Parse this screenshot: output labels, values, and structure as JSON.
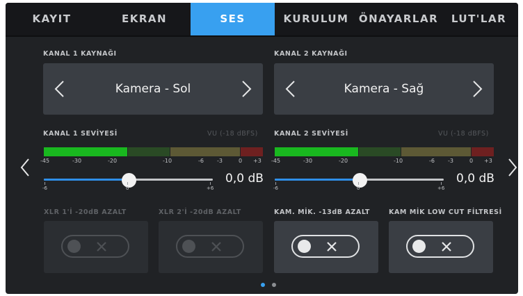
{
  "tabs": [
    "KAYIT",
    "EKRAN",
    "SES",
    "KURULUM",
    "ÖNAYARLAR",
    "LUT'LAR"
  ],
  "active_tab": "SES",
  "channel1": {
    "source_label": "KANAL 1 KAYNAĞI",
    "source_value": "Kamera - Sol",
    "level_label": "KANAL 1 SEVİYESİ",
    "vu_label": "VU (-18 dBFS)",
    "db_value": "0,0 dB",
    "level_fraction": 0.5
  },
  "channel2": {
    "source_label": "KANAL 2 KAYNAĞI",
    "source_value": "Kamera - Sağ",
    "level_label": "KANAL 2 SEVİYESİ",
    "vu_label": "VU (-18 dBFS)",
    "db_value": "0,0 dB",
    "level_fraction": 0.5
  },
  "meter_ticks": [
    "-45",
    "-30",
    "-20",
    "-10",
    "-6",
    "-3",
    "0",
    "+3"
  ],
  "slider_ticks": [
    "-6",
    "0",
    "+6"
  ],
  "meter_colors": {
    "green_bright": "#19b81f",
    "green_dark": "#2a4a25",
    "olive": "#5d5935",
    "red": "#6e2020"
  },
  "accent_color": "#38a0f0",
  "toggles": [
    {
      "label": "XLR 1'İ -20dB AZALT",
      "enabled": false,
      "state": "off"
    },
    {
      "label": "XLR 2'İ -20dB AZALT",
      "enabled": false,
      "state": "off"
    },
    {
      "label": "KAM. MİK. -13dB AZALT",
      "enabled": true,
      "state": "off"
    },
    {
      "label": "KAM MİK LOW CUT FİLTRESİ",
      "enabled": true,
      "state": "off"
    }
  ],
  "pages": {
    "current": 1,
    "total": 2
  }
}
